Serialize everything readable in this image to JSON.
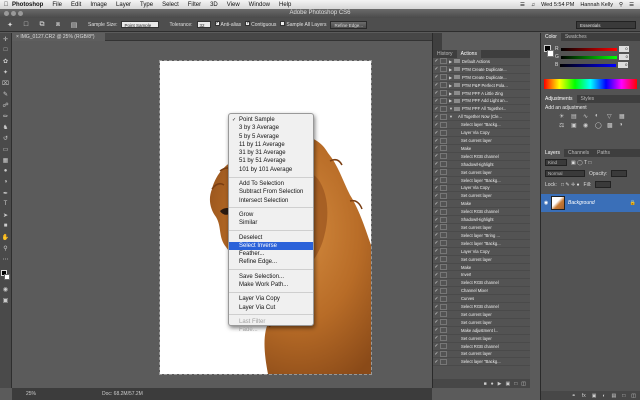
{
  "menubar": {
    "app": "Photoshop",
    "items": [
      "File",
      "Edit",
      "Image",
      "Layer",
      "Type",
      "Select",
      "Filter",
      "3D",
      "View",
      "Window",
      "Help"
    ],
    "clock": "Wed 5:54 PM",
    "user": "Hannah Kelly"
  },
  "window": {
    "title": "Adobe Photoshop CS6"
  },
  "options": {
    "sample_size_label": "Sample Size:",
    "sample_size_value": "Point Sample",
    "tolerance_label": "Tolerance:",
    "tolerance_value": "32",
    "anti_alias": "Anti-alias",
    "contiguous": "Contiguous",
    "sample_all_layers": "Sample All Layers",
    "refine_edge": "Refine Edge...",
    "workspace": "Essentials"
  },
  "document": {
    "tab_label": "IMG_0127.CR2 @ 25% (RGB/8*)"
  },
  "context_menu": {
    "items": [
      {
        "label": "Point Sample",
        "checked": true
      },
      {
        "label": "3 by 3 Average"
      },
      {
        "label": "5 by 5 Average"
      },
      {
        "label": "11 by 11 Average"
      },
      {
        "label": "31 by 31 Average"
      },
      {
        "label": "51 by 51 Average"
      },
      {
        "label": "101 by 101 Average"
      },
      {
        "sep": true
      },
      {
        "label": "Add To Selection"
      },
      {
        "label": "Subtract From Selection"
      },
      {
        "label": "Intersect Selection"
      },
      {
        "sep": true
      },
      {
        "label": "Grow"
      },
      {
        "label": "Similar"
      },
      {
        "sep": true
      },
      {
        "label": "Deselect"
      },
      {
        "label": "Select Inverse",
        "highlighted": true
      },
      {
        "label": "Feather..."
      },
      {
        "label": "Refine Edge..."
      },
      {
        "sep": true
      },
      {
        "label": "Save Selection..."
      },
      {
        "label": "Make Work Path..."
      },
      {
        "sep": true
      },
      {
        "label": "Layer Via Copy"
      },
      {
        "label": "Layer Via Cut"
      },
      {
        "sep": true
      },
      {
        "label": "Last Filter",
        "disabled": true
      },
      {
        "label": "Fade...",
        "disabled": true
      }
    ]
  },
  "status": {
    "zoom": "25%",
    "doc": "Doc: 68.2M/57.2M"
  },
  "actions_panel": {
    "tabs": [
      "History",
      "Actions"
    ],
    "rows": [
      {
        "label": "Default Actions",
        "kind": "set"
      },
      {
        "label": "PTM Create Duplicate...",
        "kind": "set"
      },
      {
        "label": "PTM Create Duplicate...",
        "kind": "set"
      },
      {
        "label": "PTM P&P Perfect Pola...",
        "kind": "set"
      },
      {
        "label": "PTM PPF A Little Zing",
        "kind": "set"
      },
      {
        "label": "PTM PPF Add Light an...",
        "kind": "set"
      },
      {
        "label": "PTM PPF All Together...",
        "kind": "set"
      },
      {
        "label": "All Together Now (Cle...",
        "kind": "sub"
      },
      {
        "label": "Select layer \"Backg...",
        "kind": "step"
      },
      {
        "label": "Layer Via Copy",
        "kind": "step"
      },
      {
        "label": "Set current layer",
        "kind": "step"
      },
      {
        "label": "Make",
        "kind": "step"
      },
      {
        "label": "Select RGB channel",
        "kind": "step"
      },
      {
        "label": "Shadow/Highlight",
        "kind": "step"
      },
      {
        "label": "Set current layer",
        "kind": "step"
      },
      {
        "label": "Select layer \"Backg...",
        "kind": "step"
      },
      {
        "label": "Layer Via Copy",
        "kind": "step"
      },
      {
        "label": "Set current layer",
        "kind": "step"
      },
      {
        "label": "Make",
        "kind": "step"
      },
      {
        "label": "Select RGB channel",
        "kind": "step"
      },
      {
        "label": "Shadow/Highlight",
        "kind": "step"
      },
      {
        "label": "Set current layer",
        "kind": "step"
      },
      {
        "label": "Select layer \"Bring ...",
        "kind": "step"
      },
      {
        "label": "Select layer \"Backg...",
        "kind": "step"
      },
      {
        "label": "Layer Via Copy",
        "kind": "step"
      },
      {
        "label": "Set current layer",
        "kind": "step"
      },
      {
        "label": "Make",
        "kind": "step"
      },
      {
        "label": "Invert",
        "kind": "step"
      },
      {
        "label": "Select RGB channel",
        "kind": "step"
      },
      {
        "label": "Channel Mixer",
        "kind": "step"
      },
      {
        "label": "Curves",
        "kind": "step"
      },
      {
        "label": "Select RGB channel",
        "kind": "step"
      },
      {
        "label": "Set current layer",
        "kind": "step"
      },
      {
        "label": "Set current layer",
        "kind": "step"
      },
      {
        "label": "Make adjustment l...",
        "kind": "step"
      },
      {
        "label": "Set current layer",
        "kind": "step"
      },
      {
        "label": "Select RGB channel",
        "kind": "step"
      },
      {
        "label": "Set current layer",
        "kind": "step"
      },
      {
        "label": "Select layer \"Backg...",
        "kind": "step"
      }
    ]
  },
  "color_panel": {
    "tabs": [
      "Color",
      "Swatches"
    ],
    "sliders": [
      {
        "label": "R",
        "value": "0",
        "color": "#ff0000"
      },
      {
        "label": "G",
        "value": "0",
        "color": "#00ff00"
      },
      {
        "label": "B",
        "value": "0",
        "color": "#0000ff"
      }
    ]
  },
  "adjustments_panel": {
    "tabs": [
      "Adjustments",
      "Styles"
    ],
    "title": "Add an adjustment"
  },
  "layers_panel": {
    "tabs": [
      "Layers",
      "Channels",
      "Paths"
    ],
    "kind_filter": "Kind",
    "blend_mode": "Normal",
    "opacity_label": "Opacity:",
    "lock_label": "Lock:",
    "fill_label": "Fill:",
    "layer_name": "Background"
  }
}
